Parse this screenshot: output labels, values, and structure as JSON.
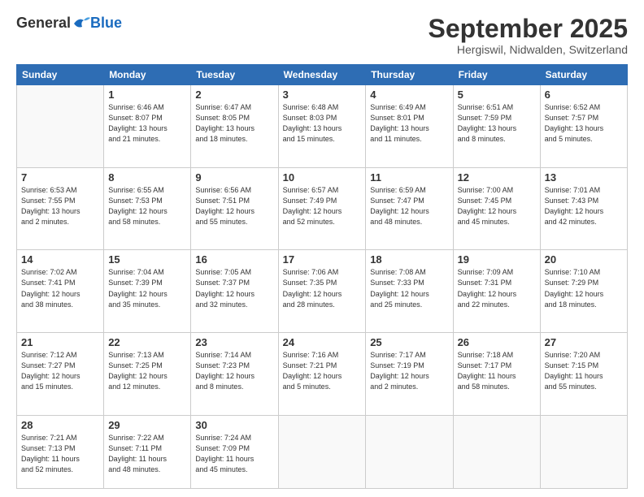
{
  "logo": {
    "general": "General",
    "blue": "Blue"
  },
  "header": {
    "month": "September 2025",
    "location": "Hergiswil, Nidwalden, Switzerland"
  },
  "weekdays": [
    "Sunday",
    "Monday",
    "Tuesday",
    "Wednesday",
    "Thursday",
    "Friday",
    "Saturday"
  ],
  "weeks": [
    [
      {
        "day": "",
        "info": ""
      },
      {
        "day": "1",
        "info": "Sunrise: 6:46 AM\nSunset: 8:07 PM\nDaylight: 13 hours\nand 21 minutes."
      },
      {
        "day": "2",
        "info": "Sunrise: 6:47 AM\nSunset: 8:05 PM\nDaylight: 13 hours\nand 18 minutes."
      },
      {
        "day": "3",
        "info": "Sunrise: 6:48 AM\nSunset: 8:03 PM\nDaylight: 13 hours\nand 15 minutes."
      },
      {
        "day": "4",
        "info": "Sunrise: 6:49 AM\nSunset: 8:01 PM\nDaylight: 13 hours\nand 11 minutes."
      },
      {
        "day": "5",
        "info": "Sunrise: 6:51 AM\nSunset: 7:59 PM\nDaylight: 13 hours\nand 8 minutes."
      },
      {
        "day": "6",
        "info": "Sunrise: 6:52 AM\nSunset: 7:57 PM\nDaylight: 13 hours\nand 5 minutes."
      }
    ],
    [
      {
        "day": "7",
        "info": "Sunrise: 6:53 AM\nSunset: 7:55 PM\nDaylight: 13 hours\nand 2 minutes."
      },
      {
        "day": "8",
        "info": "Sunrise: 6:55 AM\nSunset: 7:53 PM\nDaylight: 12 hours\nand 58 minutes."
      },
      {
        "day": "9",
        "info": "Sunrise: 6:56 AM\nSunset: 7:51 PM\nDaylight: 12 hours\nand 55 minutes."
      },
      {
        "day": "10",
        "info": "Sunrise: 6:57 AM\nSunset: 7:49 PM\nDaylight: 12 hours\nand 52 minutes."
      },
      {
        "day": "11",
        "info": "Sunrise: 6:59 AM\nSunset: 7:47 PM\nDaylight: 12 hours\nand 48 minutes."
      },
      {
        "day": "12",
        "info": "Sunrise: 7:00 AM\nSunset: 7:45 PM\nDaylight: 12 hours\nand 45 minutes."
      },
      {
        "day": "13",
        "info": "Sunrise: 7:01 AM\nSunset: 7:43 PM\nDaylight: 12 hours\nand 42 minutes."
      }
    ],
    [
      {
        "day": "14",
        "info": "Sunrise: 7:02 AM\nSunset: 7:41 PM\nDaylight: 12 hours\nand 38 minutes."
      },
      {
        "day": "15",
        "info": "Sunrise: 7:04 AM\nSunset: 7:39 PM\nDaylight: 12 hours\nand 35 minutes."
      },
      {
        "day": "16",
        "info": "Sunrise: 7:05 AM\nSunset: 7:37 PM\nDaylight: 12 hours\nand 32 minutes."
      },
      {
        "day": "17",
        "info": "Sunrise: 7:06 AM\nSunset: 7:35 PM\nDaylight: 12 hours\nand 28 minutes."
      },
      {
        "day": "18",
        "info": "Sunrise: 7:08 AM\nSunset: 7:33 PM\nDaylight: 12 hours\nand 25 minutes."
      },
      {
        "day": "19",
        "info": "Sunrise: 7:09 AM\nSunset: 7:31 PM\nDaylight: 12 hours\nand 22 minutes."
      },
      {
        "day": "20",
        "info": "Sunrise: 7:10 AM\nSunset: 7:29 PM\nDaylight: 12 hours\nand 18 minutes."
      }
    ],
    [
      {
        "day": "21",
        "info": "Sunrise: 7:12 AM\nSunset: 7:27 PM\nDaylight: 12 hours\nand 15 minutes."
      },
      {
        "day": "22",
        "info": "Sunrise: 7:13 AM\nSunset: 7:25 PM\nDaylight: 12 hours\nand 12 minutes."
      },
      {
        "day": "23",
        "info": "Sunrise: 7:14 AM\nSunset: 7:23 PM\nDaylight: 12 hours\nand 8 minutes."
      },
      {
        "day": "24",
        "info": "Sunrise: 7:16 AM\nSunset: 7:21 PM\nDaylight: 12 hours\nand 5 minutes."
      },
      {
        "day": "25",
        "info": "Sunrise: 7:17 AM\nSunset: 7:19 PM\nDaylight: 12 hours\nand 2 minutes."
      },
      {
        "day": "26",
        "info": "Sunrise: 7:18 AM\nSunset: 7:17 PM\nDaylight: 11 hours\nand 58 minutes."
      },
      {
        "day": "27",
        "info": "Sunrise: 7:20 AM\nSunset: 7:15 PM\nDaylight: 11 hours\nand 55 minutes."
      }
    ],
    [
      {
        "day": "28",
        "info": "Sunrise: 7:21 AM\nSunset: 7:13 PM\nDaylight: 11 hours\nand 52 minutes."
      },
      {
        "day": "29",
        "info": "Sunrise: 7:22 AM\nSunset: 7:11 PM\nDaylight: 11 hours\nand 48 minutes."
      },
      {
        "day": "30",
        "info": "Sunrise: 7:24 AM\nSunset: 7:09 PM\nDaylight: 11 hours\nand 45 minutes."
      },
      {
        "day": "",
        "info": ""
      },
      {
        "day": "",
        "info": ""
      },
      {
        "day": "",
        "info": ""
      },
      {
        "day": "",
        "info": ""
      }
    ]
  ]
}
